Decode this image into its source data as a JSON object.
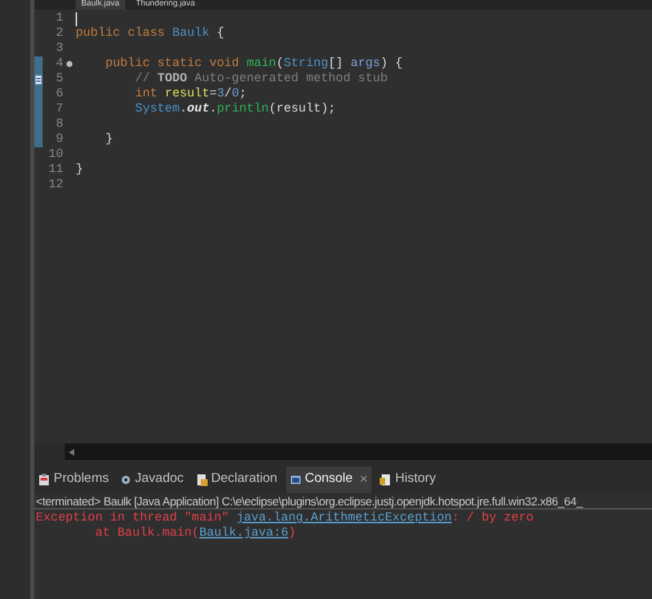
{
  "editor_tabs": [
    {
      "label": "Baulk.java",
      "selected": true
    },
    {
      "label": "Thundering.java",
      "selected": false
    }
  ],
  "code_lines": [
    {
      "number": "1",
      "changed": false,
      "caret": true,
      "fold": false,
      "task": false
    },
    {
      "number": "2",
      "changed": false,
      "caret": false,
      "fold": false,
      "task": false,
      "tokens": [
        {
          "text": "public class ",
          "kind": "keyword"
        },
        {
          "text": "Baulk",
          "kind": "type"
        },
        {
          "text": " {",
          "kind": "plain"
        }
      ]
    },
    {
      "number": "3",
      "changed": false,
      "caret": false,
      "fold": false,
      "task": false
    },
    {
      "number": "4",
      "changed": true,
      "caret": false,
      "fold": true,
      "task": false,
      "tokens": [
        {
          "text": "    public static void ",
          "kind": "keyword"
        },
        {
          "text": "main",
          "kind": "method"
        },
        {
          "text": "(",
          "kind": "plain"
        },
        {
          "text": "String",
          "kind": "type"
        },
        {
          "text": "[] ",
          "kind": "plain"
        },
        {
          "text": "args",
          "kind": "param"
        },
        {
          "text": ") {",
          "kind": "plain"
        }
      ]
    },
    {
      "number": "5",
      "changed": true,
      "caret": false,
      "fold": false,
      "task": true,
      "tokens": [
        {
          "text": "        // ",
          "kind": "comment"
        },
        {
          "text": "TODO",
          "kind": "todo"
        },
        {
          "text": " Auto-generated method stub",
          "kind": "comment"
        }
      ]
    },
    {
      "number": "6",
      "changed": true,
      "caret": false,
      "fold": false,
      "task": false,
      "tokens": [
        {
          "text": "        int ",
          "kind": "keyword"
        },
        {
          "text": "result",
          "kind": "variable"
        },
        {
          "text": "=",
          "kind": "plain"
        },
        {
          "text": "3",
          "kind": "number"
        },
        {
          "text": "/",
          "kind": "plain"
        },
        {
          "text": "0",
          "kind": "number"
        },
        {
          "text": ";",
          "kind": "plain"
        }
      ]
    },
    {
      "number": "7",
      "changed": true,
      "caret": false,
      "fold": false,
      "task": false,
      "tokens": [
        {
          "text": "        System",
          "kind": "type"
        },
        {
          "text": ".",
          "kind": "plain"
        },
        {
          "text": "out",
          "kind": "field"
        },
        {
          "text": ".",
          "kind": "plain"
        },
        {
          "text": "println",
          "kind": "method"
        },
        {
          "text": "(result);",
          "kind": "plain"
        }
      ]
    },
    {
      "number": "8",
      "changed": true,
      "caret": false,
      "fold": false,
      "task": false
    },
    {
      "number": "9",
      "changed": true,
      "caret": false,
      "fold": false,
      "task": false,
      "tokens": [
        {
          "text": "    }",
          "kind": "plain"
        }
      ]
    },
    {
      "number": "10",
      "changed": false,
      "caret": false,
      "fold": false,
      "task": false
    },
    {
      "number": "11",
      "changed": false,
      "caret": false,
      "fold": false,
      "task": false,
      "tokens": [
        {
          "text": "}",
          "kind": "plain"
        }
      ]
    },
    {
      "number": "12",
      "changed": false,
      "caret": false,
      "fold": false,
      "task": false
    }
  ],
  "panel_tabs": [
    {
      "label": "Problems",
      "selected": false,
      "closable": false
    },
    {
      "label": "Javadoc",
      "selected": false,
      "closable": false
    },
    {
      "label": "Declaration",
      "selected": false,
      "closable": false
    },
    {
      "label": "Console",
      "selected": true,
      "closable": true,
      "close": "×"
    },
    {
      "label": "History",
      "selected": false,
      "closable": false
    }
  ],
  "console": {
    "header": "<terminated> Baulk [Java Application] C:\\e\\eclipse\\plugins\\org.eclipse.justj.openjdk.hotspot.jre.full.win32.x86_64_",
    "lines": [
      {
        "tokens": [
          {
            "text": "Exception in thread \"main\" ",
            "kind": "error"
          },
          {
            "text": "java.lang.ArithmeticException",
            "kind": "link"
          },
          {
            "text": ": / by zero",
            "kind": "error"
          }
        ]
      },
      {
        "tokens": [
          {
            "text": "        at Baulk.main(",
            "kind": "error"
          },
          {
            "text": "Baulk.java:6",
            "kind": "link"
          },
          {
            "text": ")",
            "kind": "error"
          }
        ]
      }
    ]
  }
}
